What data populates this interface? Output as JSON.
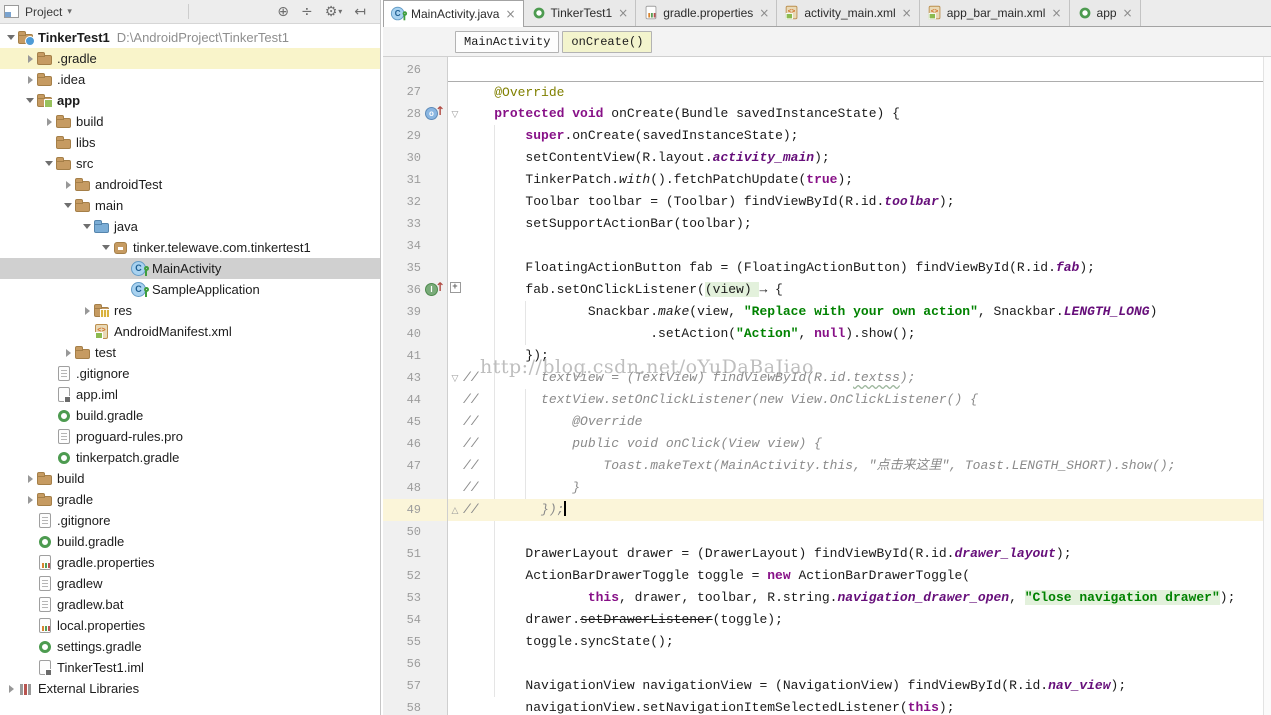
{
  "colors": {
    "keyword": "#871087",
    "annotation": "#808000",
    "string": "#008200",
    "constant": "#660e7a",
    "comment": "#8a8a8a",
    "current_line": "#fbf5d9",
    "green_highlight": "#e3f1dc",
    "tree_selection": "#d0d0d0",
    "tree_highlight": "#f9f4ca",
    "gutter": "#f0f0f0"
  },
  "project_panel": {
    "title": "Project",
    "dropdown_glyph": "▾",
    "toolbar_icons": [
      {
        "name": "locate-icon",
        "glyph": "⊕"
      },
      {
        "name": "collapse-all-icon",
        "glyph": "÷"
      },
      {
        "name": "settings-gear-icon",
        "glyph": "⚙"
      },
      {
        "name": "hide-panel-icon",
        "glyph": "↤"
      }
    ],
    "tree": [
      {
        "label": "TinkerTest1",
        "path": "D:\\AndroidProject\\TinkerTest1",
        "level": 0,
        "icon": "project",
        "expand": "open",
        "bold": true
      },
      {
        "label": ".gradle",
        "level": 1,
        "icon": "folder",
        "expand": "closed",
        "highlight": true
      },
      {
        "label": ".idea",
        "level": 1,
        "icon": "folder",
        "expand": "closed"
      },
      {
        "label": "app",
        "level": 1,
        "icon": "folder-app",
        "expand": "open",
        "bold": true
      },
      {
        "label": "build",
        "level": 2,
        "icon": "folder",
        "expand": "closed"
      },
      {
        "label": "libs",
        "level": 2,
        "icon": "folder"
      },
      {
        "label": "src",
        "level": 2,
        "icon": "folder",
        "expand": "open"
      },
      {
        "label": "androidTest",
        "level": 3,
        "icon": "folder",
        "expand": "closed"
      },
      {
        "label": "main",
        "level": 3,
        "icon": "folder",
        "expand": "open"
      },
      {
        "label": "java",
        "level": 4,
        "icon": "folder-blue",
        "expand": "open"
      },
      {
        "label": "tinker.telewave.com.tinkertest1",
        "level": 5,
        "icon": "package",
        "expand": "open"
      },
      {
        "label": "MainActivity",
        "level": 6,
        "icon": "class",
        "selected": true
      },
      {
        "label": "SampleApplication",
        "level": 6,
        "icon": "class"
      },
      {
        "label": "res",
        "level": 4,
        "icon": "folder-res",
        "expand": "closed"
      },
      {
        "label": "AndroidManifest.xml",
        "level": 4,
        "icon": "xml"
      },
      {
        "label": "test",
        "level": 3,
        "icon": "folder",
        "expand": "closed"
      },
      {
        "label": ".gitignore",
        "level": 2,
        "icon": "file"
      },
      {
        "label": "app.iml",
        "level": 2,
        "icon": "iml"
      },
      {
        "label": "build.gradle",
        "level": 2,
        "icon": "gradle"
      },
      {
        "label": "proguard-rules.pro",
        "level": 2,
        "icon": "file"
      },
      {
        "label": "tinkerpatch.gradle",
        "level": 2,
        "icon": "gradle"
      },
      {
        "label": "build",
        "level": 1,
        "icon": "folder",
        "expand": "closed"
      },
      {
        "label": "gradle",
        "level": 1,
        "icon": "folder",
        "expand": "closed"
      },
      {
        "label": ".gitignore",
        "level": 1,
        "icon": "file"
      },
      {
        "label": "build.gradle",
        "level": 1,
        "icon": "gradle"
      },
      {
        "label": "gradle.properties",
        "level": 1,
        "icon": "props"
      },
      {
        "label": "gradlew",
        "level": 1,
        "icon": "file"
      },
      {
        "label": "gradlew.bat",
        "level": 1,
        "icon": "file"
      },
      {
        "label": "local.properties",
        "level": 1,
        "icon": "props"
      },
      {
        "label": "settings.gradle",
        "level": 1,
        "icon": "gradle"
      },
      {
        "label": "TinkerTest1.iml",
        "level": 1,
        "icon": "iml"
      },
      {
        "label": "External Libraries",
        "level": 0,
        "icon": "lib",
        "expand": "closed"
      }
    ]
  },
  "tabs": [
    {
      "label": "MainActivity.java",
      "icon": "class",
      "active": true
    },
    {
      "label": "TinkerTest1",
      "icon": "gradle",
      "active": false
    },
    {
      "label": "gradle.properties",
      "icon": "props",
      "active": false
    },
    {
      "label": "activity_main.xml",
      "icon": "xml",
      "active": false
    },
    {
      "label": "app_bar_main.xml",
      "icon": "xml",
      "active": false
    },
    {
      "label": "app",
      "icon": "gradle",
      "active": false
    }
  ],
  "tab_close_glyph": "×",
  "breadcrumbs": [
    {
      "label": "MainActivity",
      "active": false
    },
    {
      "label": "onCreate()",
      "active": true
    }
  ],
  "editor": {
    "watermark": "http://blog.csdn.net/oYuDaBaJiao",
    "fold_glyphs": {
      "open": "▽",
      "close": "△",
      "plus": "+"
    },
    "lines": [
      {
        "n": 26,
        "segs": []
      },
      {
        "n": 27,
        "sep": true,
        "segs": [
          [
            "p",
            "    "
          ],
          [
            "a",
            "@Override"
          ]
        ]
      },
      {
        "n": 28,
        "g": "ovr",
        "f": "open",
        "segs": [
          [
            "p",
            "    "
          ],
          [
            "k",
            "protected"
          ],
          [
            "p",
            " "
          ],
          [
            "k",
            "void"
          ],
          [
            "p",
            " onCreate(Bundle savedInstanceState) {"
          ]
        ]
      },
      {
        "n": 29,
        "segs": [
          [
            "p",
            "        "
          ],
          [
            "k",
            "super"
          ],
          [
            "p",
            ".onCreate(savedInstanceState);"
          ]
        ]
      },
      {
        "n": 30,
        "segs": [
          [
            "p",
            "        setContentView(R.layout."
          ],
          [
            "fd",
            "activity_main"
          ],
          [
            "p",
            ");"
          ]
        ]
      },
      {
        "n": 31,
        "segs": [
          [
            "p",
            "        TinkerPatch."
          ],
          [
            "sm",
            "with"
          ],
          [
            "p",
            "().fetchPatchUpdate("
          ],
          [
            "k",
            "true"
          ],
          [
            "p",
            ");"
          ]
        ]
      },
      {
        "n": 32,
        "segs": [
          [
            "p",
            "        Toolbar toolbar = (Toolbar) findViewById(R.id."
          ],
          [
            "fd",
            "toolbar"
          ],
          [
            "p",
            ");"
          ]
        ]
      },
      {
        "n": 33,
        "segs": [
          [
            "p",
            "        setSupportActionBar(toolbar);"
          ]
        ]
      },
      {
        "n": 34,
        "segs": []
      },
      {
        "n": 35,
        "segs": [
          [
            "p",
            "        FloatingActionButton fab = (FloatingActionButton) findViewById(R.id."
          ],
          [
            "fd",
            "fab"
          ],
          [
            "p",
            ");"
          ]
        ]
      },
      {
        "n": 36,
        "g": "impl",
        "f": "plus",
        "segs": [
          [
            "p",
            "        fab.setOnClickListener("
          ],
          [
            "hl",
            "(view) "
          ],
          [
            "p",
            "→ {"
          ]
        ]
      },
      {
        "n": 39,
        "segs": [
          [
            "p",
            "                Snackbar."
          ],
          [
            "sm",
            "make"
          ],
          [
            "p",
            "(view, "
          ],
          [
            "s",
            "\"Replace with your own action\""
          ],
          [
            "p",
            ", Snackbar."
          ],
          [
            "fd",
            "LENGTH_LONG"
          ],
          [
            "p",
            ")"
          ]
        ]
      },
      {
        "n": 40,
        "segs": [
          [
            "p",
            "                        .setAction("
          ],
          [
            "s",
            "\"Action\""
          ],
          [
            "p",
            ", "
          ],
          [
            "k",
            "null"
          ],
          [
            "p",
            ").show();"
          ]
        ]
      },
      {
        "n": 41,
        "segs": [
          [
            "p",
            "        });"
          ]
        ]
      },
      {
        "n": 43,
        "f": "open",
        "segs": [
          [
            "cm",
            "//        textView = (TextView) findViewById(R.id."
          ],
          [
            "ce",
            "textss"
          ],
          [
            "cm",
            ");"
          ]
        ]
      },
      {
        "n": 44,
        "segs": [
          [
            "cm",
            "//        textView.setOnClickListener(new View.OnClickListener() {"
          ]
        ]
      },
      {
        "n": 45,
        "segs": [
          [
            "cm",
            "//            @Override"
          ]
        ]
      },
      {
        "n": 46,
        "segs": [
          [
            "cm",
            "//            public void onClick(View view) {"
          ]
        ]
      },
      {
        "n": 47,
        "segs": [
          [
            "cm",
            "//                Toast.makeText(MainActivity.this, \"点击来这里\", Toast.LENGTH_SHORT).show();"
          ]
        ]
      },
      {
        "n": 48,
        "segs": [
          [
            "cm",
            "//            }"
          ]
        ]
      },
      {
        "n": 49,
        "f": "close",
        "cur": true,
        "caret": true,
        "segs": [
          [
            "cm",
            "//        });"
          ]
        ]
      },
      {
        "n": 50,
        "segs": []
      },
      {
        "n": 51,
        "segs": [
          [
            "p",
            "        DrawerLayout drawer = (DrawerLayout) findViewById(R.id."
          ],
          [
            "fd",
            "drawer_layout"
          ],
          [
            "p",
            ");"
          ]
        ]
      },
      {
        "n": 52,
        "segs": [
          [
            "p",
            "        ActionBarDrawerToggle toggle = "
          ],
          [
            "k",
            "new"
          ],
          [
            "p",
            " ActionBarDrawerToggle("
          ]
        ]
      },
      {
        "n": 53,
        "segs": [
          [
            "p",
            "                "
          ],
          [
            "k",
            "this"
          ],
          [
            "p",
            ", drawer, toolbar, R.string."
          ],
          [
            "fd",
            "navigation_drawer_open"
          ],
          [
            "p",
            ", "
          ],
          [
            "sh",
            "\"Close navigation drawer\""
          ],
          [
            "p",
            ");"
          ]
        ]
      },
      {
        "n": 54,
        "segs": [
          [
            "p",
            "        drawer."
          ],
          [
            "dp",
            "setDrawerListener"
          ],
          [
            "p",
            "(toggle);"
          ]
        ]
      },
      {
        "n": 55,
        "segs": [
          [
            "p",
            "        toggle.syncState();"
          ]
        ]
      },
      {
        "n": 56,
        "segs": []
      },
      {
        "n": 57,
        "segs": [
          [
            "p",
            "        NavigationView navigationView = (NavigationView) findViewById(R.id."
          ],
          [
            "fd",
            "nav_view"
          ],
          [
            "p",
            ");"
          ]
        ]
      },
      {
        "n": 58,
        "segs": [
          [
            "p",
            "        navigationView.setNavigationItemSelectedListener("
          ],
          [
            "k",
            "this"
          ],
          [
            "p",
            ");"
          ]
        ]
      }
    ]
  }
}
